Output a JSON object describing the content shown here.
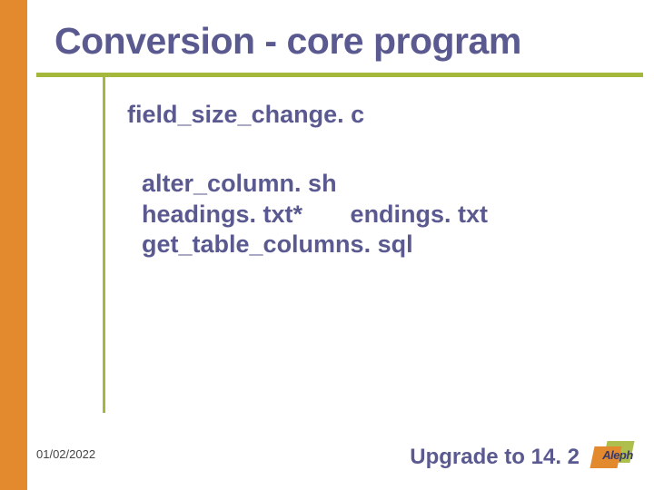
{
  "title": "Conversion - core program",
  "content": {
    "file_main": "field_size_change. c",
    "sub": {
      "line1": "alter_column. sh",
      "line2_left": "headings. txt*",
      "line2_right": "endings. txt",
      "line3": "get_table_columns. sql"
    }
  },
  "footer": {
    "date": "01/02/2022",
    "label": "Upgrade to 14. 2",
    "logo_text": "Aleph"
  }
}
